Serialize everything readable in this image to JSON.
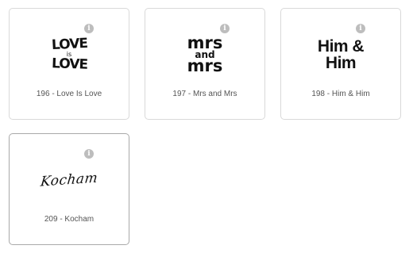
{
  "cards": [
    {
      "label": "196 - Love Is Love",
      "art": {
        "line1": "LOVE",
        "line2": "is",
        "line3": "LOVE"
      }
    },
    {
      "label": "197 - Mrs and Mrs",
      "art": {
        "line1": "mrs",
        "line2": "and",
        "line3": "mrs"
      }
    },
    {
      "label": "198 - Him & Him",
      "art": {
        "line1": "Him &",
        "line2": "Him"
      }
    },
    {
      "label": "209 - Kocham",
      "art": {
        "line1": "Kocham"
      }
    }
  ],
  "info_glyph": "i",
  "colors": {
    "border": "#d9d9d9",
    "info": "#bdbdbd",
    "label": "#555555",
    "art": "#111111"
  }
}
